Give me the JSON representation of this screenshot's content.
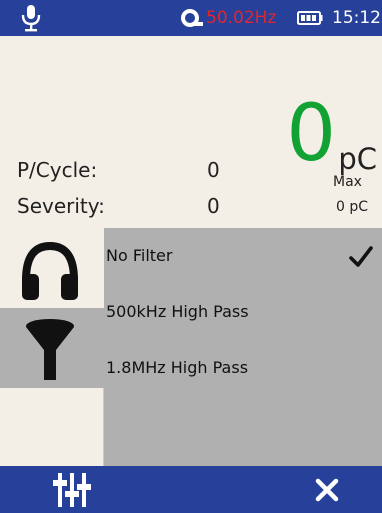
{
  "status_bar": {
    "frequency": "50.02Hz",
    "time": "15:12",
    "icons": [
      "microphone-icon",
      "measurement-icon",
      "battery-icon"
    ]
  },
  "readout": {
    "value": "0",
    "unit": "pC",
    "p_cycle_label": "P/Cycle:",
    "p_cycle_value": "0",
    "severity_label": "Severity:",
    "severity_value": "0",
    "max_label": "Max",
    "max_value": "0 pC"
  },
  "side_icons": [
    "headphones-icon",
    "filter-icon"
  ],
  "filter_menu": {
    "items": [
      {
        "label": "No Filter",
        "selected": true
      },
      {
        "label": "500kHz High Pass",
        "selected": false
      },
      {
        "label": "1.8MHz High Pass",
        "selected": false
      }
    ]
  },
  "bottom_bar": {
    "icons": [
      "sliders-icon",
      "close-icon"
    ]
  },
  "colors": {
    "bar": "#27409a",
    "value_green": "#12a233",
    "freq_red": "#e1262c",
    "panel_grey": "#b0b0b0",
    "background": "#f3efe7"
  }
}
